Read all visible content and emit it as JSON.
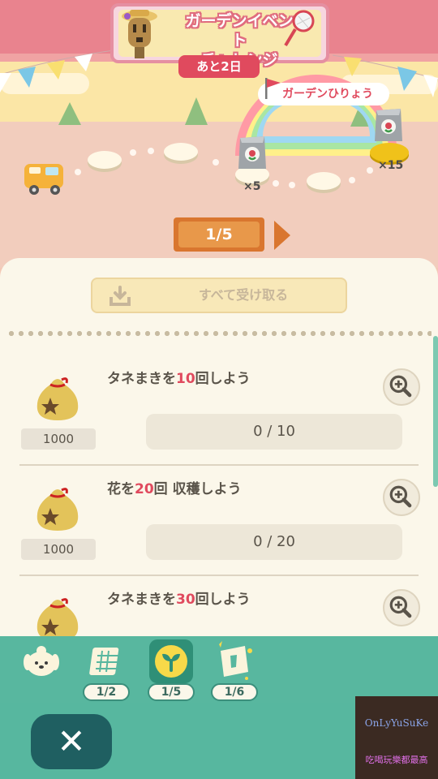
{
  "event": {
    "title_line1": "ガーデンイベント",
    "title_line2": "チャレンジ",
    "days_left": "あと2日",
    "garden_label": "ガーデンひりょう"
  },
  "map": {
    "rewards": [
      {
        "icon": "fertilizer-bag-icon",
        "count": "×5"
      },
      {
        "icon": "fertilizer-bag-gold-icon",
        "count": "×15"
      }
    ],
    "page": "1/5"
  },
  "panel": {
    "claim_all_label": "すべて受け取る",
    "tasks": [
      {
        "text_before": "タネまきを",
        "num": "10",
        "text_after": "回しよう",
        "reward": "1000",
        "progress": "0 / 10"
      },
      {
        "text_before": "花を",
        "num": "20",
        "text_after": "回 収穫しよう",
        "reward": "1000",
        "progress": "0 / 20"
      },
      {
        "text_before": "タネまきを",
        "num": "30",
        "text_after": "回しよう",
        "reward": "",
        "progress": ""
      }
    ]
  },
  "tabs": [
    {
      "name": "isabelle-tab",
      "icon": "isabelle-icon",
      "count": ""
    },
    {
      "name": "calendar-tab",
      "icon": "calendar-icon",
      "count": "1/2"
    },
    {
      "name": "sprout-tab",
      "icon": "sprout-icon",
      "count": "1/5"
    },
    {
      "name": "ticket-tab",
      "icon": "ticket-icon",
      "count": "1/6"
    }
  ],
  "watermark": {
    "line1": "OnLyYuSuKe",
    "line2": "吃喝玩樂都最高"
  },
  "colors": {
    "accent_red": "#e04a5e",
    "tabbar_green": "#58b79f",
    "close_button": "#1f5f61",
    "page_orange": "#d9762f"
  }
}
